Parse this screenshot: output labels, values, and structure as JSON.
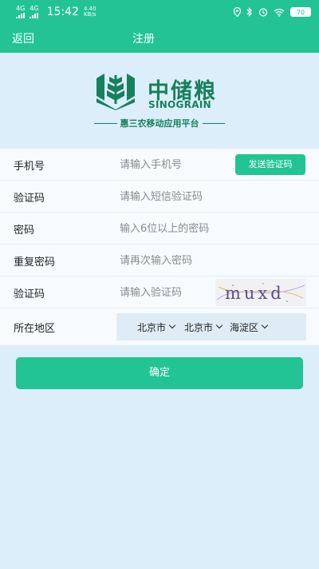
{
  "status_bar": {
    "network_left": "4G",
    "network_right": "4G",
    "time": "15:42",
    "speed_value": "4.40",
    "speed_unit": "KB/s",
    "battery": "70"
  },
  "header": {
    "back_label": "返回",
    "title": "注册"
  },
  "logo": {
    "name_cn": "中储粮",
    "name_en": "SINOGRAIN",
    "slogan": "惠三农移动应用平台"
  },
  "form": {
    "phone": {
      "label": "手机号",
      "placeholder": "请输入手机号",
      "value": ""
    },
    "send_code_label": "发送验证码",
    "sms_code": {
      "label": "验证码",
      "placeholder": "请输入短信验证码",
      "value": ""
    },
    "password": {
      "label": "密码",
      "placeholder": "输入6位以上的密码",
      "value": ""
    },
    "password_confirm": {
      "label": "重复密码",
      "placeholder": "请再次输入密码",
      "value": ""
    },
    "captcha": {
      "label": "验证码",
      "placeholder": "请输入验证码",
      "value": "",
      "image_text": "muxd"
    },
    "region": {
      "label": "所在地区",
      "province": "北京市",
      "city": "北京市",
      "district": "海淀区"
    }
  },
  "confirm_label": "确定",
  "colors": {
    "primary": "#23c395",
    "brand_dark": "#17805c",
    "background": "#dbeefa",
    "form_background": "#f7fbfe"
  }
}
